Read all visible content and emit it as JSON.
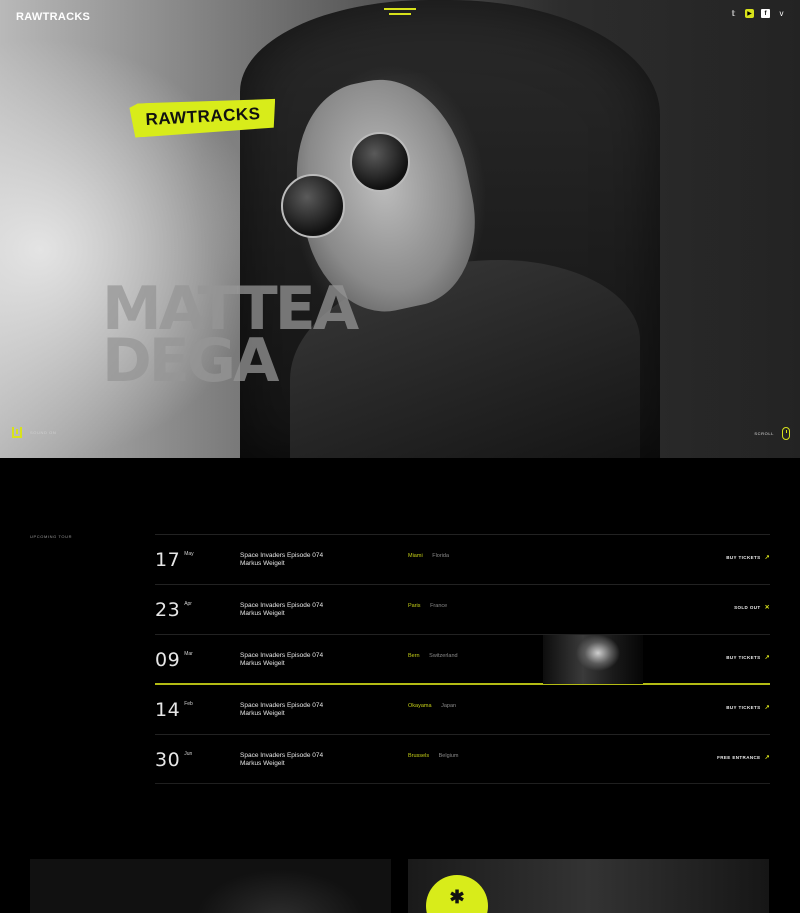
{
  "header": {
    "logo": "RAWTRACKS",
    "socials": [
      {
        "icon": "twitter-icon",
        "glyph": "𝕥"
      },
      {
        "icon": "youtube-icon",
        "glyph": "▶"
      },
      {
        "icon": "facebook-icon",
        "glyph": "f"
      },
      {
        "icon": "vimeo-icon",
        "glyph": "v"
      }
    ]
  },
  "hero": {
    "sticker_text": "RAWTRACKS",
    "name_line1": "MATTEA",
    "name_line2": "DEGA",
    "scroll_down_label": "SOUND ON",
    "scroll_label": "SCROLL"
  },
  "tour": {
    "label": "UPCOMING TOUR",
    "rows": [
      {
        "day": "17",
        "month": "May",
        "event_line1": "Space Invaders Episode 074",
        "event_line2": "Markus Weigelt",
        "city": "Miami",
        "country": "Florida",
        "action": "BUY TICKETS",
        "action_icon": "↗"
      },
      {
        "day": "23",
        "month": "Apr",
        "event_line1": "Space Invaders Episode 074",
        "event_line2": "Markus Weigelt",
        "city": "Paris",
        "country": "France",
        "action": "SOLD OUT",
        "action_icon": "✕"
      },
      {
        "day": "09",
        "month": "Mar",
        "event_line1": "Space Invaders Episode 074",
        "event_line2": "Markus Weigelt",
        "city": "Bern",
        "country": "Switzerland",
        "action": "BUY TICKETS",
        "action_icon": "↗"
      },
      {
        "day": "14",
        "month": "Feb",
        "event_line1": "Space Invaders Episode 074",
        "event_line2": "Markus Weigelt",
        "city": "Okayama",
        "country": "Japan",
        "action": "BUY TICKETS",
        "action_icon": "↗"
      },
      {
        "day": "30",
        "month": "Jun",
        "event_line1": "Space Invaders Episode 074",
        "event_line2": "Markus Weigelt",
        "city": "Brussels",
        "country": "Belgium",
        "action": "FREE ENTRANCE",
        "action_icon": "↗"
      }
    ]
  },
  "colors": {
    "accent": "#d8ec1a",
    "background": "#000000"
  }
}
